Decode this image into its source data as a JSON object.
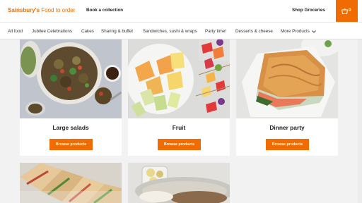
{
  "header": {
    "logo_brand": "Sainsbury's",
    "logo_suffix": "Food to order",
    "book_collection": "Book a collection",
    "shop_groceries": "Shop Groceries",
    "basket_count": "0"
  },
  "nav": {
    "items": [
      "All food",
      "Jubilee Celebrations",
      "Cakes",
      "Sharing & buffet",
      "Sandwiches, sushi & wraps",
      "Party time!",
      "Desserts & cheese",
      "More Products"
    ]
  },
  "cards": [
    {
      "title": "Large salads",
      "button": "Browse products"
    },
    {
      "title": "Fruit",
      "button": "Browse products"
    },
    {
      "title": "Dinner party",
      "button": "Browse products"
    }
  ],
  "colors": {
    "brand": "#f06c00"
  },
  "icons": {
    "basket": "basket-icon",
    "more": "chevron-down-icon"
  }
}
